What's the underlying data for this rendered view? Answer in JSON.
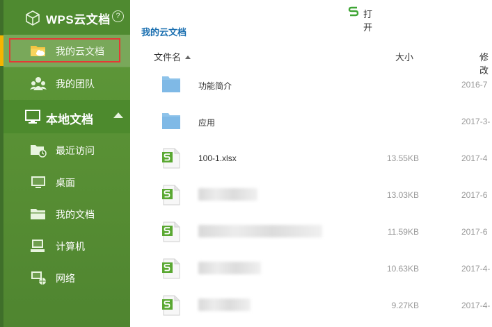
{
  "sidebar": {
    "header": {
      "title": "WPS云文档",
      "help_glyph": "?"
    },
    "cloud_items": [
      {
        "label": "我的云文档",
        "icon": "folder-cloud-icon",
        "selected": true
      },
      {
        "label": "我的团队",
        "icon": "team-icon",
        "selected": false
      }
    ],
    "local_section": {
      "label": "本地文档",
      "icon": "monitor-icon"
    },
    "local_items": [
      {
        "label": "最近访问",
        "icon": "recent-folder-icon"
      },
      {
        "label": "桌面",
        "icon": "desktop-icon"
      },
      {
        "label": "我的文档",
        "icon": "documents-folder-icon"
      },
      {
        "label": "计算机",
        "icon": "computer-icon"
      },
      {
        "label": "网络",
        "icon": "network-icon"
      }
    ]
  },
  "toolbar": {
    "open_label": "打开",
    "open_icon": "wps-s-logo-icon"
  },
  "breadcrumb": "我的云文档",
  "columns": {
    "name": "文件名",
    "size": "大小",
    "date": "修改"
  },
  "files": [
    {
      "name": "功能简介",
      "type": "folder",
      "size": "",
      "date": "2016-7",
      "blurred": false
    },
    {
      "name": "应用",
      "type": "folder",
      "size": "",
      "date": "2017-3-",
      "blurred": false
    },
    {
      "name": "100-1.xlsx",
      "type": "sheet",
      "size": "13.55KB",
      "date": "2017-4",
      "blurred": false
    },
    {
      "name": "",
      "type": "sheet",
      "size": "13.03KB",
      "date": "2017-6",
      "blurred": true
    },
    {
      "name": "",
      "type": "sheet",
      "size": "11.59KB",
      "date": "2017-6",
      "blurred": true
    },
    {
      "name": "",
      "type": "sheet",
      "size": "10.63KB",
      "date": "2017-4-",
      "blurred": true
    },
    {
      "name": "",
      "type": "sheet",
      "size": "9.27KB",
      "date": "2017-4-",
      "blurred": true
    }
  ],
  "colors": {
    "sidebar": "#5a9336",
    "selected": "#79a85a",
    "highlight_border": "#e53935",
    "accent_bar": "#f5b400",
    "link": "#1a6fb0",
    "folder": "#7fb9e6",
    "sheet": "#5aa832"
  }
}
